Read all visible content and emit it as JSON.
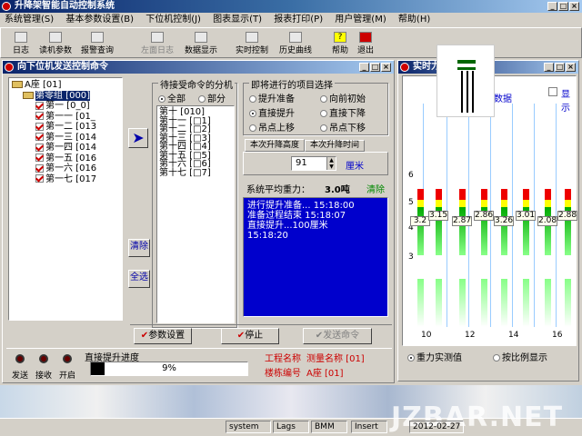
{
  "app": {
    "title": "升降架智能自动控制系统"
  },
  "menu": [
    "系统管理(S)",
    "基本参数设置(B)",
    "下位机控制(J)",
    "图表显示(T)",
    "报表打印(P)",
    "用户管理(M)",
    "帮助(H)"
  ],
  "toolbar": [
    "日志",
    "读机参数",
    "报警查询",
    "左面日志",
    "数据显示",
    "实时控制",
    "历史曲线",
    "帮助",
    "退出"
  ],
  "child": {
    "title": "向下位机发送控制命令",
    "tree": {
      "root": "A座 [01]",
      "group": "第零组 [000]",
      "items": [
        "第一 [0_0]",
        "第一一 [01_",
        "第一二 [013",
        "第一三 [014",
        "第一四 [014",
        "第一五 [016",
        "第一六 [016",
        "第一七 [017"
      ]
    },
    "send_arrow": "➤",
    "cmd_group": {
      "caption": "待接受命令的分机",
      "radio_all": "全部",
      "radio_part": "部分",
      "list": [
        "第十 [010]",
        "第十一 [□1]",
        "第十二 [□2]",
        "第十三 [□3]",
        "第十四 [□4]",
        "第十五 [□5]",
        "第十六 [□6]",
        "第十七 [□7]"
      ]
    },
    "side_btns": [
      "清除",
      "全选"
    ],
    "proj_group": {
      "caption": "即将进行的项目选择",
      "items": [
        "提升准备",
        "向前初始",
        "直接提升",
        "直接下降",
        "吊点上移",
        "吊点下移"
      ],
      "selected": 2
    },
    "tabs": [
      "本次升降高度",
      "本次升降时间"
    ],
    "height_value": "91",
    "height_unit": "厘米",
    "avg_label": "系统平均重力：",
    "avg_value": "3.0吨",
    "avg_btn": "清除",
    "log": [
      "进行提升准备...  15:18:00",
      "准备过程结束 15:18:07",
      "直接提升...100厘米",
      "15:18:20"
    ],
    "buttons": [
      "参数设置",
      "停止",
      "发送命令"
    ],
    "progress": {
      "caption": "直接提升进度",
      "value": "9%",
      "fraction": 0.09
    },
    "lamps": [
      "发送",
      "接收",
      "开启"
    ],
    "proj_name_label": "工程名称",
    "proj_name_value": "测量名称 [01]",
    "tower_label": "楼栋编号",
    "tower_value": "A座 [01]"
  },
  "rt": {
    "title": "实时力",
    "legend": "数据",
    "check_label": "显示",
    "ticks_x": [
      "10",
      "12",
      "14",
      "16"
    ],
    "ticks_y": [
      "6",
      "5",
      "4",
      "3"
    ],
    "values": [
      "3.2",
      "3.15",
      "2.87",
      "2.86",
      "3.26",
      "3.01",
      "2.08",
      "2.88"
    ],
    "radios": [
      "重力实测值",
      "按比例显示"
    ]
  },
  "status": [
    "system",
    "Lags",
    "BMM",
    "Insert",
    "2012-02-27"
  ],
  "watermark": "JZBAR.NET"
}
